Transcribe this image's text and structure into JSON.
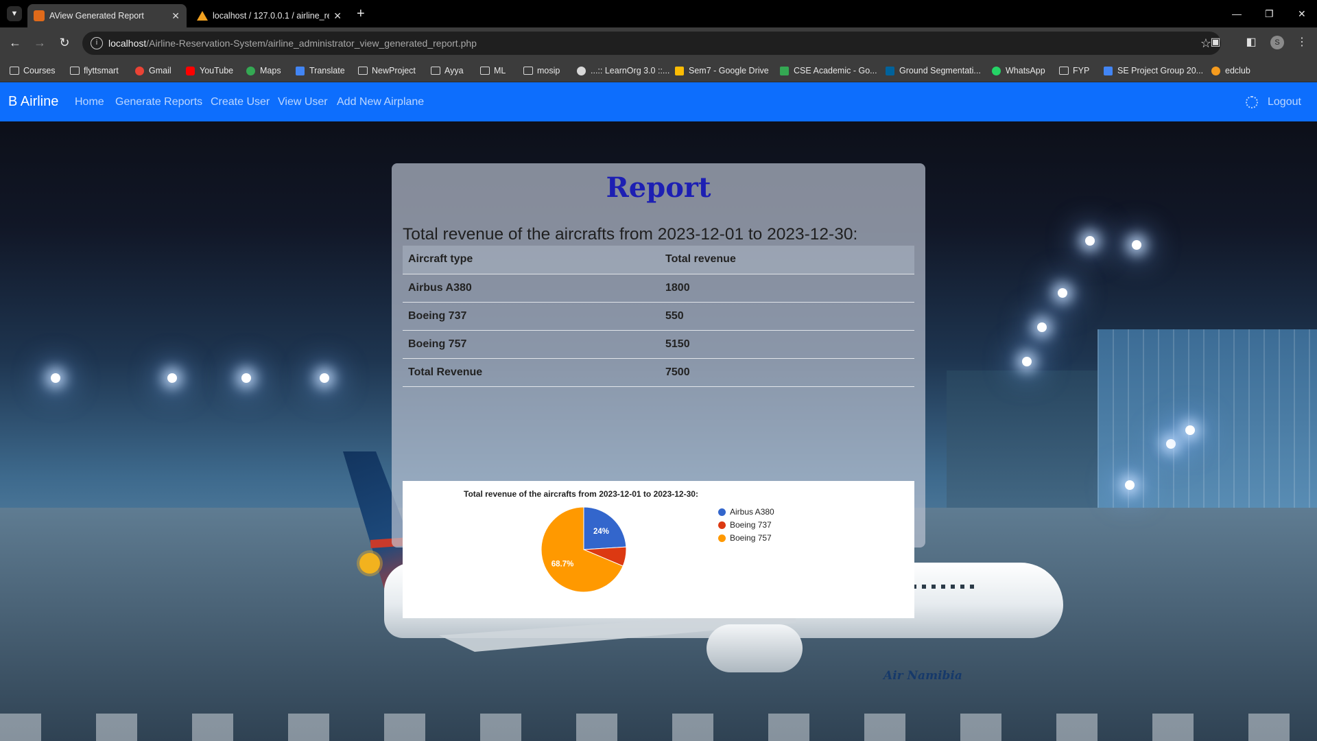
{
  "browser": {
    "tabs": [
      {
        "title": "AView Generated Report",
        "active": true
      },
      {
        "title": "localhost / 127.0.0.1 / airline_re",
        "active": false
      }
    ],
    "url_host": "localhost",
    "url_path": "/Airline-Reservation-System/airline_administrator_view_generated_report.php",
    "profile_initial": "S",
    "bookmarks": [
      "Courses",
      "flyttsmart",
      "Gmail",
      "YouTube",
      "Maps",
      "Translate",
      "NewProject",
      "Ayya",
      "ML",
      "mosip",
      "...:: LearnOrg 3.0 ::...",
      "Sem7 - Google Drive",
      "CSE Academic - Go...",
      "Ground Segmentati...",
      "WhatsApp",
      "FYP",
      "SE Project Group 20...",
      "edclub"
    ]
  },
  "navbar": {
    "brand": "B Airline",
    "links": [
      "Home",
      "Generate Reports",
      "Create User",
      "View User",
      "Add New Airplane"
    ],
    "logout": "Logout"
  },
  "report": {
    "title": "Report",
    "subtitle": "Total revenue of the aircrafts from 2023-12-01 to 2023-12-30:",
    "columns": [
      "Aircraft type",
      "Total revenue"
    ],
    "rows": [
      {
        "type": "Airbus A380",
        "revenue": "1800"
      },
      {
        "type": "Boeing 737",
        "revenue": "550"
      },
      {
        "type": "Boeing 757",
        "revenue": "5150"
      },
      {
        "type": "Total Revenue",
        "revenue": "7500"
      }
    ]
  },
  "background": {
    "aircraft_livery_text": "Air Namibia"
  },
  "chart_data": {
    "type": "pie",
    "title": "Total revenue of the aircrafts from 2023-12-01 to 2023-12-30:",
    "categories": [
      "Airbus A380",
      "Boeing 737",
      "Boeing 757"
    ],
    "values": [
      1800,
      550,
      5150
    ],
    "slice_labels": [
      "24%",
      "",
      "68.7%"
    ],
    "colors": [
      "#3366cc",
      "#dc3912",
      "#ff9900"
    ],
    "legend_position": "right"
  },
  "colors": {
    "navbar": "#0d6efd",
    "report_title": "#1d1fb3"
  }
}
